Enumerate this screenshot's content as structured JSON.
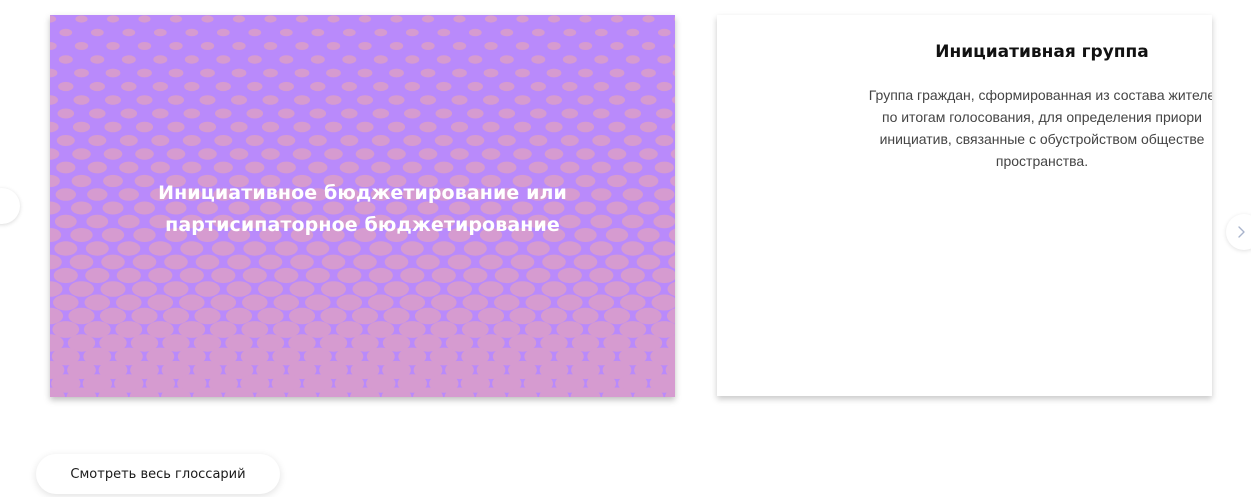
{
  "slider": {
    "card_image": {
      "title_line1": "Инициативное бюджетирование или",
      "title_line2": "партисипаторное бюджетирование",
      "background_color": "#b98afb",
      "dot_color": "#d69bd0"
    },
    "card_text": {
      "title": "Инициативная группа",
      "desc_line1": "Группа граждан, сформированная из состава жителе",
      "desc_line2": "по итогам голосования, для определения приори",
      "desc_line3": "инициатив, связанные с обустройством обществе",
      "desc_line4": "пространства."
    },
    "prev_arrow_icon": "chevron-left-icon",
    "next_arrow_icon": "chevron-right-icon"
  },
  "glossary_button": {
    "label": "Смотреть весь глоссарий"
  }
}
